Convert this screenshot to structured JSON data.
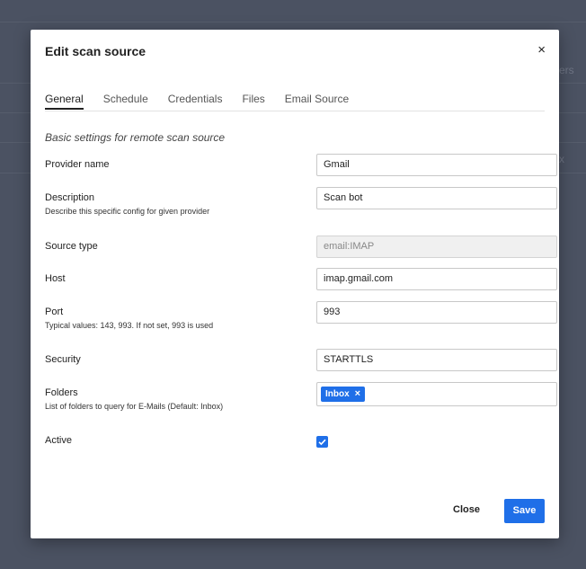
{
  "background": {
    "peek_1": "ers",
    "peek_2": "x"
  },
  "modal": {
    "title": "Edit scan source",
    "close_icon": "×",
    "tabs": [
      {
        "label": "General",
        "active": true
      },
      {
        "label": "Schedule",
        "active": false
      },
      {
        "label": "Credentials",
        "active": false
      },
      {
        "label": "Files",
        "active": false
      },
      {
        "label": "Email Source",
        "active": false
      }
    ],
    "subtitle": "Basic settings for remote scan source",
    "fields": {
      "provider": {
        "label": "Provider name",
        "value": "Gmail"
      },
      "description": {
        "label": "Description",
        "hint": "Describe this specific config for given provider",
        "value": "Scan bot"
      },
      "source_type": {
        "label": "Source type",
        "value": "email:IMAP"
      },
      "host": {
        "label": "Host",
        "value": "imap.gmail.com"
      },
      "port": {
        "label": "Port",
        "hint": "Typical values: 143, 993. If not set, 993 is used",
        "value": "993"
      },
      "security": {
        "label": "Security",
        "value": "STARTTLS"
      },
      "folders": {
        "label": "Folders",
        "hint": "List of folders to query for E-Mails (Default: Inbox)",
        "tags": [
          "Inbox"
        ],
        "tag_remove": "×"
      },
      "active": {
        "label": "Active",
        "checked": true
      }
    },
    "buttons": {
      "close": "Close",
      "save": "Save"
    }
  },
  "colors": {
    "accent": "#1f6fe8",
    "backdrop": "#4b5262"
  }
}
